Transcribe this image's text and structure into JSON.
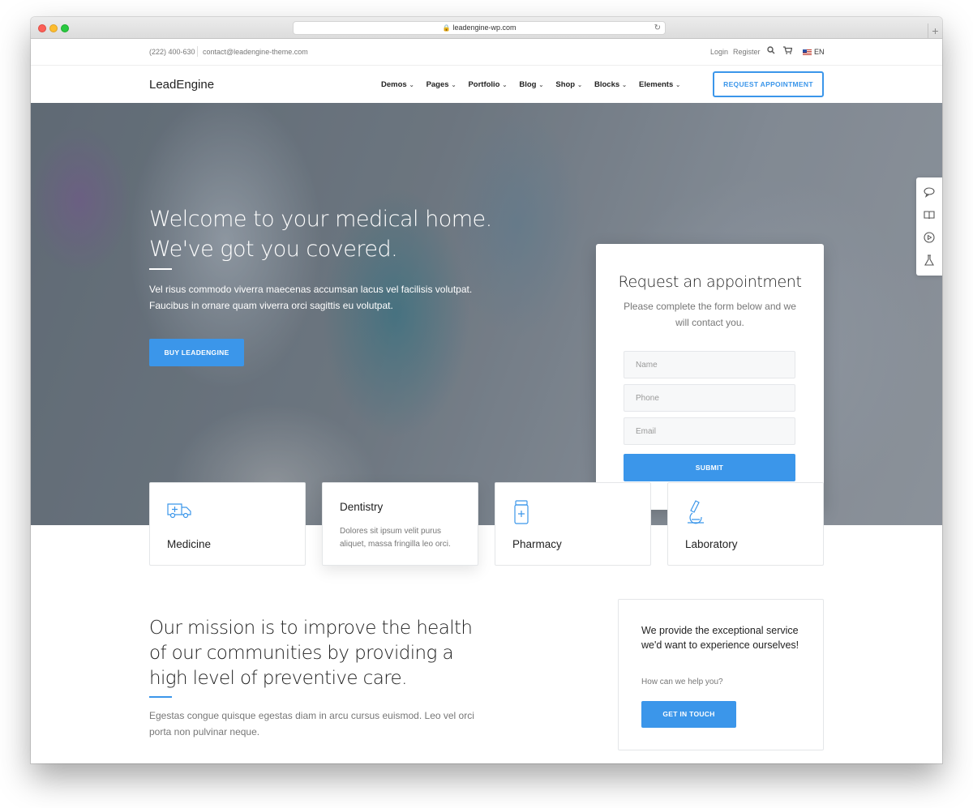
{
  "browser": {
    "url": "leadengine-wp.com"
  },
  "topbar": {
    "phone": "(222) 400-630",
    "email": "contact@leadengine-theme.com",
    "login": "Login",
    "register": "Register",
    "language": "EN"
  },
  "nav": {
    "logo": "LeadEngine",
    "items": [
      {
        "label": "Demos"
      },
      {
        "label": "Pages"
      },
      {
        "label": "Portfolio"
      },
      {
        "label": "Blog"
      },
      {
        "label": "Shop"
      },
      {
        "label": "Blocks"
      },
      {
        "label": "Elements"
      }
    ],
    "cta": "REQUEST APPOINTMENT"
  },
  "hero": {
    "title_line1": "Welcome to your medical home.",
    "title_line2": "We've got you covered.",
    "text": "Vel risus commodo viverra maecenas accumsan lacus vel facilisis volutpat. Faucibus in ornare quam viverra orci sagittis eu volutpat.",
    "button": "BUY LEADENGINE"
  },
  "appointment_form": {
    "title": "Request an appointment",
    "subtitle": "Please complete the form below and we will contact you.",
    "name_placeholder": "Name",
    "phone_placeholder": "Phone",
    "email_placeholder": "Email",
    "submit": "SUBMIT"
  },
  "services": [
    {
      "label": "Medicine",
      "icon": "ambulance-icon"
    },
    {
      "label": "Dentistry",
      "desc": "Dolores sit ipsum velit purus aliquet, massa fringilla leo orci."
    },
    {
      "label": "Pharmacy",
      "icon": "medicine-bottle-icon"
    },
    {
      "label": "Laboratory",
      "icon": "microscope-icon"
    }
  ],
  "mission": {
    "title": "Our mission is to improve the health of our communities by providing a high level of preventive care.",
    "text": "Egestas congue quisque egestas diam in arcu cursus euismod. Leo vel orci porta non pulvinar neque."
  },
  "cta_card": {
    "title": "We provide the exceptional service we'd want to experience ourselves!",
    "subtitle": "How can we help you?",
    "button": "GET IN TOUCH"
  },
  "colors": {
    "accent": "#3b96ea"
  }
}
